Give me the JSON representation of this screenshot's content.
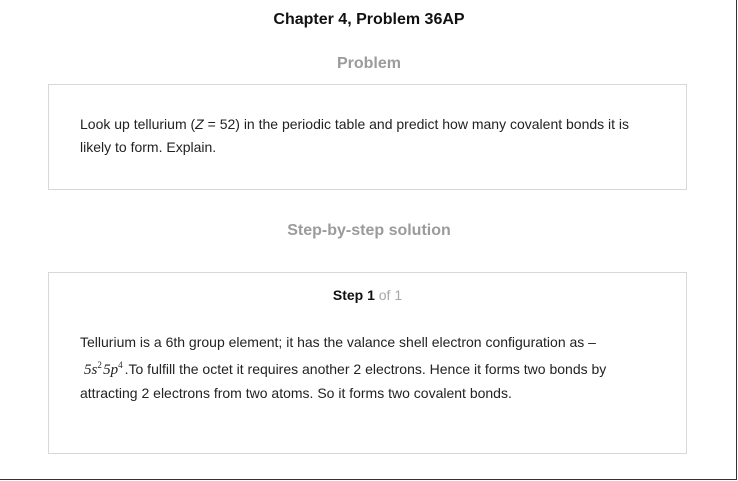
{
  "header": {
    "chapter_title": "Chapter 4, Problem 36AP"
  },
  "problem": {
    "heading": "Problem",
    "text_before": "Look up tellurium (",
    "variable": "Z",
    "text_after": " = 52) in the periodic table and predict how many covalent bonds it is likely to form. Explain."
  },
  "solution": {
    "heading": "Step-by-step solution",
    "step_label": "Step 1",
    "step_total": "of 1",
    "text_intro": "Tellurium is a 6th group element; it has the valance shell electron configuration as –",
    "config": {
      "s_base": "5s",
      "s_exp": "2",
      "p_base": "5p",
      "p_exp": "4"
    },
    "text_after": ".To fulfill the octet it requires another 2 electrons. Hence it forms two bonds by attracting 2 electrons from two atoms. So it forms two covalent bonds."
  }
}
